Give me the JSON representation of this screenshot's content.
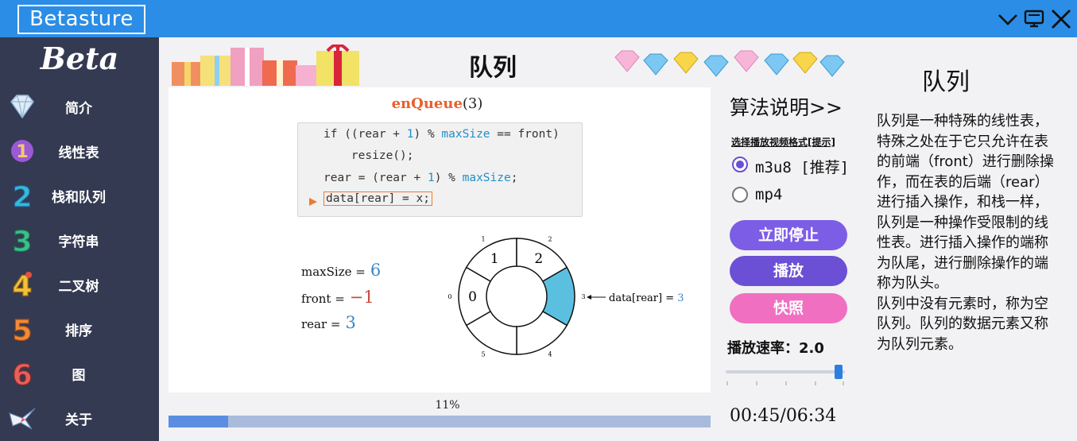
{
  "window": {
    "title": "Betasture",
    "controls": [
      "chevron-down-icon",
      "monitor-icon",
      "close-icon"
    ]
  },
  "sidebar": {
    "brand": "Beta",
    "items": [
      {
        "label": "简介",
        "icon": "diamond-icon"
      },
      {
        "label": "线性表",
        "icon": "number-1-icon"
      },
      {
        "label": "栈和队列",
        "icon": "number-2-icon"
      },
      {
        "label": "字符串",
        "icon": "number-3-icon"
      },
      {
        "label": "二叉树",
        "icon": "number-4-icon"
      },
      {
        "label": "排序",
        "icon": "number-5-icon"
      },
      {
        "label": "图",
        "icon": "number-6-icon"
      },
      {
        "label": "关于",
        "icon": "origami-bird-icon"
      }
    ]
  },
  "main": {
    "title": "队列"
  },
  "viewer": {
    "function_name": "enQueue",
    "function_arg": "(3)",
    "code_lines": [
      {
        "pre": "if ((rear + ",
        "num": "1",
        "mid": ") % ",
        "kw": "maxSize",
        "post": " == front)"
      },
      {
        "pre": "    resize();",
        "num": "",
        "mid": "",
        "kw": "",
        "post": ""
      },
      {
        "pre": "rear = (rear + ",
        "num": "1",
        "mid": ") % ",
        "kw": "maxSize",
        "post": ";"
      },
      {
        "pre": "data[rear] = x;",
        "num": "",
        "mid": "",
        "kw": "",
        "post": ""
      }
    ],
    "current_line": 3,
    "vars": [
      {
        "name": "maxSize =",
        "value": "6",
        "color": "#3a88c8"
      },
      {
        "name": "front =",
        "value": "−1",
        "color": "#c84a3a"
      },
      {
        "name": "rear =",
        "value": "3",
        "color": "#3a88c8"
      }
    ],
    "ring": {
      "slots": [
        "0",
        "1",
        "2",
        "3",
        "4",
        "5"
      ],
      "values": {
        "0": "0",
        "1": "1",
        "2": "2"
      },
      "highlight": "3",
      "pointer_label": "data[rear] =",
      "pointer_value": "3"
    }
  },
  "progress": {
    "percent_label": "11%",
    "fraction": 0.11
  },
  "controls": {
    "algo_title": "算法说明>>",
    "format_hint": "选择播放视频格式[提示]",
    "formats": [
      {
        "label": "m3u8 [推荐]",
        "selected": true
      },
      {
        "label": "mp4",
        "selected": false
      }
    ],
    "buttons": [
      {
        "label": "立即停止",
        "color": "#7c5de6"
      },
      {
        "label": "播放",
        "color": "#6b4fd4"
      },
      {
        "label": "快照",
        "color": "#f06fc0"
      }
    ],
    "speed_label": "播放速率：2.0",
    "speed_value": 2.0,
    "speed_fraction": 0.98,
    "time": "00:45/06:34"
  },
  "description": {
    "title": "队列",
    "paragraphs": [
      "队列是一种特殊的线性表，特殊之处在于它只允许在表的前端（front）进行删除操作，而在表的后端（rear）进行插入操作，和栈一样，队列是一种操作受限制的线性表。进行插入操作的端称为队尾，进行删除操作的端称为队头。",
      "队列中没有元素时，称为空队列。队列的数据元素又称为队列元素。"
    ]
  },
  "colors": {
    "titlebar": "#2b8de6",
    "sidebar": "#343a52",
    "highlight_slot": "#5bbfe0",
    "progress_fill": "#5b8ee0",
    "progress_track": "#a9bbdd"
  }
}
